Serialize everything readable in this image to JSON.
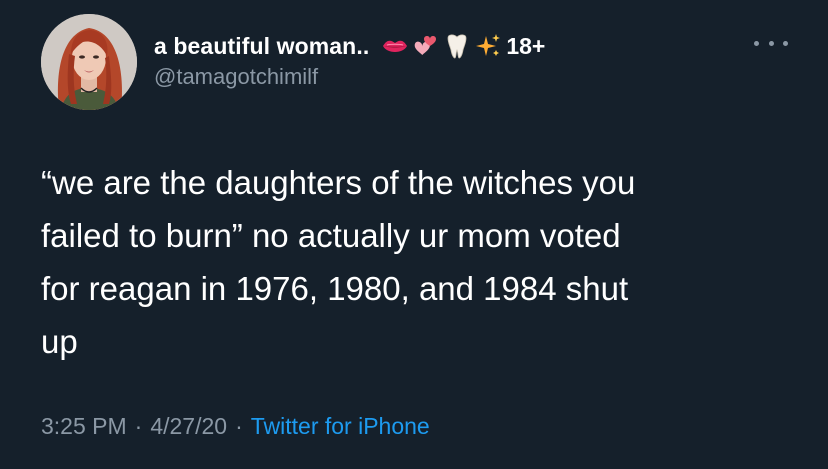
{
  "tweet": {
    "author": {
      "display_name": "a beautiful woman..",
      "badges": [
        "lips-emoji",
        "two-hearts-emoji",
        "tooth-emoji",
        "sparkles-emoji"
      ],
      "badge_text": "18+",
      "handle": "@tamagotchimilf"
    },
    "text": "“we are the daughters of the witches you\nfailed to burn” no actually ur mom voted\nfor reagan in 1976, 1980, and 1984 shut\nup",
    "time": "3:25 PM",
    "separator": "·",
    "date": "4/27/20",
    "source": "Twitter for iPhone"
  },
  "icons": {
    "more": "more-horizontal-icon"
  },
  "colors": {
    "background": "#15202b",
    "text_primary": "#ffffff",
    "text_secondary": "#8b98a5",
    "link": "#1d9bf0"
  }
}
